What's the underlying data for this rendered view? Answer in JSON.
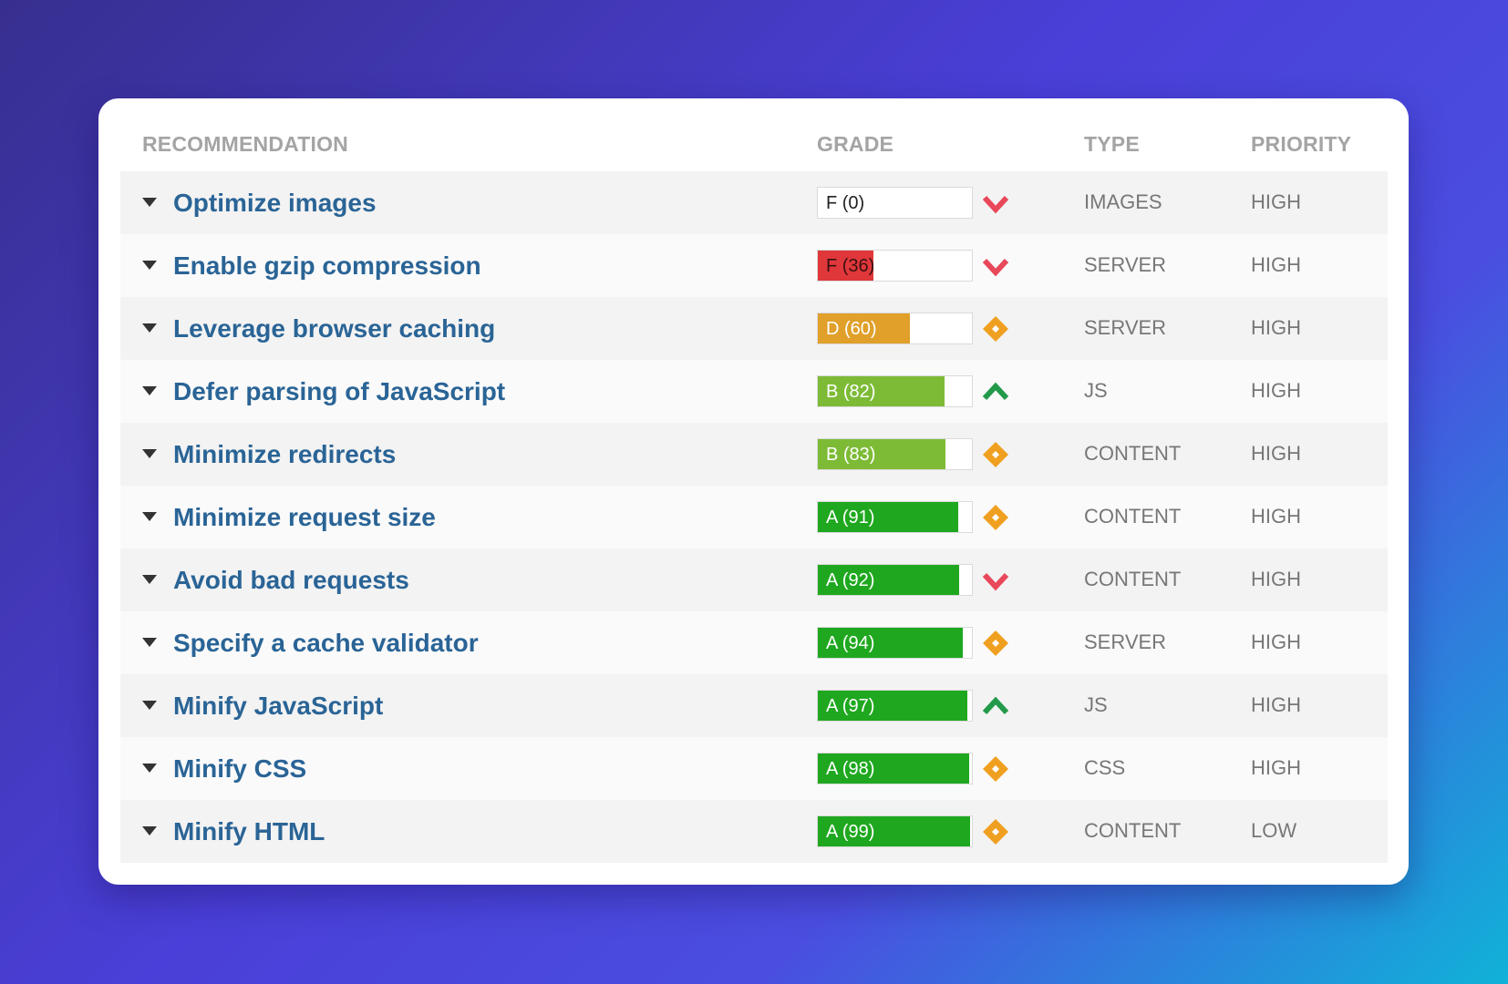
{
  "header": {
    "recommendation": "RECOMMENDATION",
    "grade": "GRADE",
    "type": "TYPE",
    "priority": "PRIORITY"
  },
  "colors": {
    "link": "#2a6496",
    "grade_A": "#1fa81f",
    "grade_B": "#7dbb36",
    "grade_D": "#e0a02a",
    "grade_F": "#e0373a",
    "trend_down": "#e8485a",
    "trend_up": "#239a4a",
    "trend_neutral": "#f0a020"
  },
  "rows": [
    {
      "label": "Optimize images",
      "grade": "F (0)",
      "score": 0,
      "letter": "F",
      "trend": "down-chevron-icon",
      "type": "IMAGES",
      "priority": "HIGH"
    },
    {
      "label": "Enable gzip compression",
      "grade": "F (36)",
      "score": 36,
      "letter": "F",
      "trend": "down-chevron-icon",
      "type": "SERVER",
      "priority": "HIGH"
    },
    {
      "label": "Leverage browser caching",
      "grade": "D (60)",
      "score": 60,
      "letter": "D",
      "trend": "diamond-icon",
      "type": "SERVER",
      "priority": "HIGH"
    },
    {
      "label": "Defer parsing of JavaScript",
      "grade": "B (82)",
      "score": 82,
      "letter": "B",
      "trend": "up-chevron-icon",
      "type": "JS",
      "priority": "HIGH"
    },
    {
      "label": "Minimize redirects",
      "grade": "B (83)",
      "score": 83,
      "letter": "B",
      "trend": "diamond-icon",
      "type": "CONTENT",
      "priority": "HIGH"
    },
    {
      "label": "Minimize request size",
      "grade": "A (91)",
      "score": 91,
      "letter": "A",
      "trend": "diamond-icon",
      "type": "CONTENT",
      "priority": "HIGH"
    },
    {
      "label": "Avoid bad requests",
      "grade": "A (92)",
      "score": 92,
      "letter": "A",
      "trend": "down-chevron-icon",
      "type": "CONTENT",
      "priority": "HIGH"
    },
    {
      "label": "Specify a cache validator",
      "grade": "A (94)",
      "score": 94,
      "letter": "A",
      "trend": "diamond-icon",
      "type": "SERVER",
      "priority": "HIGH"
    },
    {
      "label": "Minify JavaScript",
      "grade": "A (97)",
      "score": 97,
      "letter": "A",
      "trend": "up-chevron-icon",
      "type": "JS",
      "priority": "HIGH"
    },
    {
      "label": "Minify CSS",
      "grade": "A (98)",
      "score": 98,
      "letter": "A",
      "trend": "diamond-icon",
      "type": "CSS",
      "priority": "HIGH"
    },
    {
      "label": "Minify HTML",
      "grade": "A (99)",
      "score": 99,
      "letter": "A",
      "trend": "diamond-icon",
      "type": "CONTENT",
      "priority": "LOW"
    }
  ]
}
